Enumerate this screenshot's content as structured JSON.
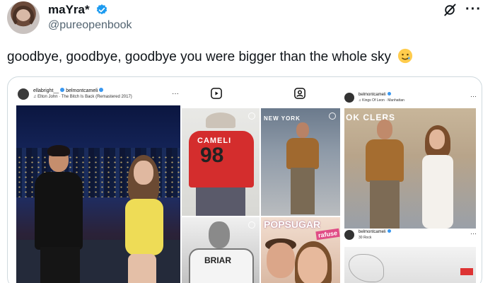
{
  "tweet": {
    "display_name": "maYra*",
    "handle": "@pureopenbook",
    "text": "goodbye, goodbye, goodbye you were bigger than the whole sky",
    "emoji": "crying-smiley-icon",
    "more": "···"
  },
  "colors": {
    "verified": "#1d9bf0",
    "text": "#0f1419",
    "muted": "#536471"
  },
  "media": {
    "left_story": {
      "users": "ellabright__",
      "users2": "belmontcameli",
      "song": "Elton John · The Bitch Is Back (Remastered 2017)",
      "more": "···"
    },
    "jersey": {
      "name": "CAMELI",
      "number": "98"
    },
    "hockey": {
      "text": "BRIAR"
    },
    "street_sign": "NEW YORK",
    "posugar": {
      "title": "POPSUGAR",
      "badge": "rafuse"
    },
    "right_story": {
      "user": "belmontcameli",
      "location": "Kings Of Leon · Manhattan",
      "sign": "OK CLERS",
      "more": "···"
    },
    "right_story2": {
      "user": "belmontcameli",
      "location": "30 Rock",
      "more": "···"
    }
  }
}
